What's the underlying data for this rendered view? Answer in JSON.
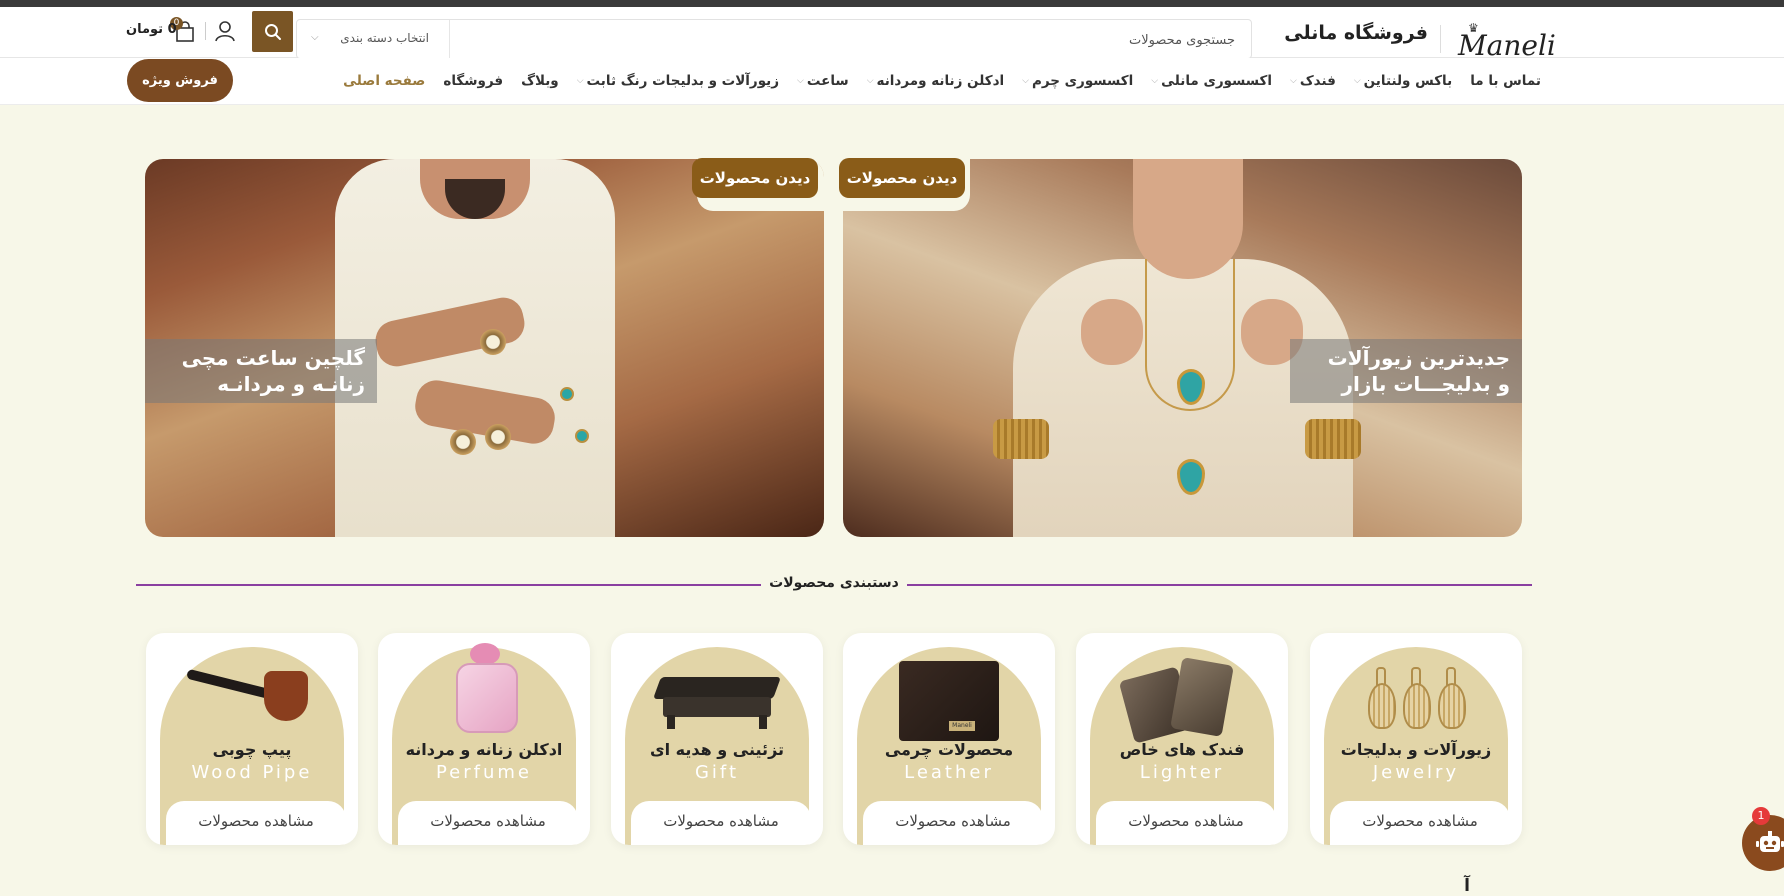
{
  "header": {
    "logo_text": "Maneli",
    "shop_name": "فروشگاه مانلی",
    "search_placeholder": "جستجوی محصولات",
    "category_select": "انتخاب دسته بندی",
    "cart_count": "0",
    "cart_total": "0 تومان"
  },
  "nav": {
    "items": [
      {
        "label": "صفحه اصلی",
        "active": true,
        "dropdown": false
      },
      {
        "label": "فروشگاه",
        "dropdown": false
      },
      {
        "label": "وبلاگ",
        "dropdown": false
      },
      {
        "label": "زیورآلات و بدلیجات رنگ ثابت",
        "dropdown": true
      },
      {
        "label": "ساعت",
        "dropdown": true
      },
      {
        "label": "ادکلن زنانه ومردانه",
        "dropdown": true
      },
      {
        "label": "اکسسوری چرم",
        "dropdown": true
      },
      {
        "label": "اکسسوری مانلی",
        "dropdown": true
      },
      {
        "label": "فندک",
        "dropdown": true
      },
      {
        "label": "باکس ولنتاین",
        "dropdown": true
      },
      {
        "label": "تماس با ما",
        "dropdown": false
      }
    ],
    "special_sale": "فروش ویژه"
  },
  "banners": {
    "left": {
      "caption_line1": "گلچین ساعت مچی",
      "caption_line2": "زنانـه و مردانـه",
      "button": "دیدن محصولات"
    },
    "right": {
      "caption_line1": "جدیدترین زیورآلات",
      "caption_line2": "و بدلیجـــات بازار",
      "button": "دیدن محصولات"
    }
  },
  "categories": {
    "title": "دستبندی محصولات",
    "items": [
      {
        "title": "زیورآلات و بدلیجات",
        "en": "Jewelry",
        "link": "مشاهده محصولات",
        "icon": "earrings-icon"
      },
      {
        "title": "فندک های خاص",
        "en": "Lighter",
        "link": "مشاهده محصولات",
        "icon": "lighter-icon"
      },
      {
        "title": "محصولات چرمی",
        "en": "Leather",
        "link": "مشاهده محصولات",
        "icon": "wallet-icon"
      },
      {
        "title": "تزئینی و هدیه ای",
        "en": "Gift",
        "link": "مشاهده محصولات",
        "icon": "gift-box-icon"
      },
      {
        "title": "ادکلن زنانه و مردانه",
        "en": "Perfume",
        "link": "مشاهده محصولات",
        "icon": "perfume-icon"
      },
      {
        "title": "پیپ چوبی",
        "en": "Wood Pipe",
        "link": "مشاهده محصولات",
        "icon": "pipe-icon"
      }
    ]
  },
  "chat": {
    "badge": "1"
  },
  "bottom_peek": "آ"
}
